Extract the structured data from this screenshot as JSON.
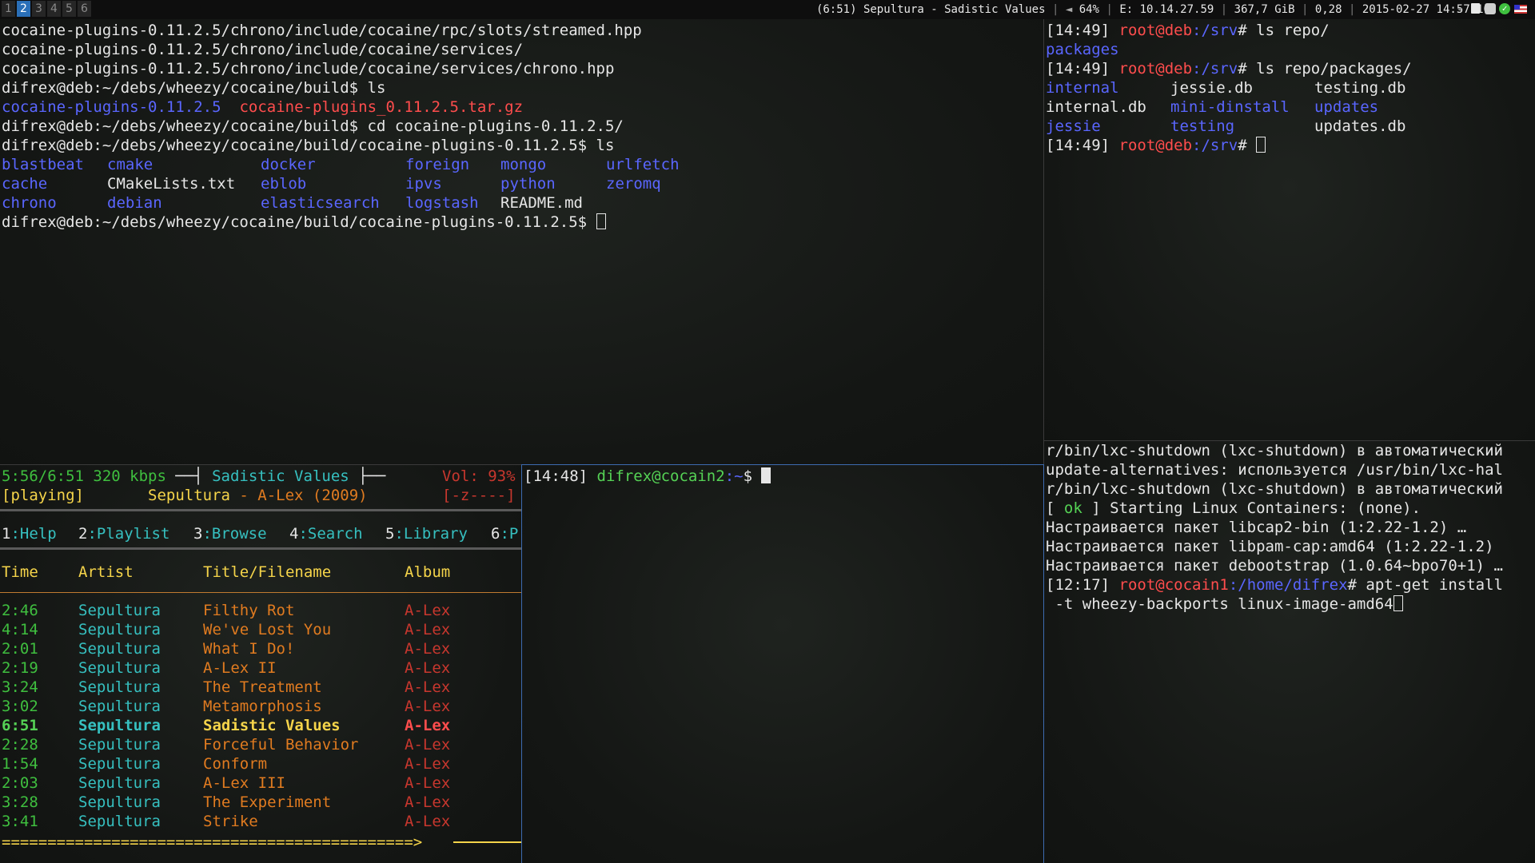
{
  "topbar": {
    "workspaces": [
      "1",
      "2",
      "3",
      "4",
      "5",
      "6"
    ],
    "active_workspace": "2",
    "now_playing": "(6:51) Sepultura - Sadistic Values",
    "battery": "64%",
    "ethernet": "E: 10.14.27.59",
    "disk": "367,7 GiB",
    "load": "0,28",
    "datetime": "2015-02-27 14:57:10",
    "sep": "|",
    "tray_icons": [
      "volume-icon",
      "clipboard-icon",
      "chat-icon",
      "check-icon",
      "flag-icon"
    ]
  },
  "term1": {
    "lines": [
      "cocaine-plugins-0.11.2.5/chrono/include/cocaine/rpc/slots/streamed.hpp",
      "cocaine-plugins-0.11.2.5/chrono/include/cocaine/services/",
      "cocaine-plugins-0.11.2.5/chrono/include/cocaine/services/chrono.hpp",
      "difrex@deb:~/debs/wheezy/cocaine/build$ ls"
    ],
    "ls1": {
      "dir": "cocaine-plugins-0.11.2.5",
      "archive": "cocaine-plugins_0.11.2.5.tar.gz"
    },
    "cmd_cd": "difrex@deb:~/debs/wheezy/cocaine/build$ cd cocaine-plugins-0.11.2.5/",
    "cmd_ls": "difrex@deb:~/debs/wheezy/cocaine/build/cocaine-plugins-0.11.2.5$ ls",
    "ls_rows": [
      [
        {
          "t": "blastbeat",
          "k": "dir"
        },
        {
          "t": "cmake",
          "k": "dir"
        },
        {
          "t": "docker",
          "k": "dir"
        },
        {
          "t": "foreign",
          "k": "dir"
        },
        {
          "t": "mongo",
          "k": "dir"
        },
        {
          "t": "urlfetch",
          "k": "dir"
        }
      ],
      [
        {
          "t": "cache",
          "k": "dir"
        },
        {
          "t": "CMakeLists.txt",
          "k": "file"
        },
        {
          "t": "eblob",
          "k": "dir"
        },
        {
          "t": "ipvs",
          "k": "dir"
        },
        {
          "t": "python",
          "k": "dir"
        },
        {
          "t": "zeromq",
          "k": "dir"
        }
      ],
      [
        {
          "t": "chrono",
          "k": "dir"
        },
        {
          "t": "debian",
          "k": "dir"
        },
        {
          "t": "elasticsearch",
          "k": "dir"
        },
        {
          "t": "logstash",
          "k": "dir"
        },
        {
          "t": "README.md",
          "k": "file"
        }
      ]
    ],
    "prompt": "difrex@deb:~/debs/wheezy/cocaine/build/cocaine-plugins-0.11.2.5$ "
  },
  "term2": {
    "p1": {
      "time": "[14:49]",
      "user": "root@deb",
      "path": ":/srv",
      "cmd": "# ls repo/"
    },
    "out1": "packages",
    "p2": {
      "time": "[14:49]",
      "user": "root@deb",
      "path": ":/srv",
      "cmd": "# ls repo/packages/"
    },
    "ls_rows": [
      [
        {
          "t": "internal",
          "k": "dir"
        },
        {
          "t": "jessie.db",
          "k": "file"
        },
        {
          "t": "testing.db",
          "k": "file"
        }
      ],
      [
        {
          "t": "internal.db",
          "k": "file"
        },
        {
          "t": "mini-dinstall",
          "k": "dir"
        },
        {
          "t": "updates",
          "k": "dir"
        }
      ],
      [
        {
          "t": "jessie",
          "k": "dir"
        },
        {
          "t": "testing",
          "k": "dir"
        },
        {
          "t": "updates.db",
          "k": "file"
        }
      ]
    ],
    "p3": {
      "time": "[14:49]",
      "user": "root@deb",
      "path": ":/srv",
      "cmd": "# "
    }
  },
  "ncmpcpp": {
    "progress": "5:56/6:51 320 kbps",
    "title": "Sadistic Values",
    "vol": "Vol: 93%",
    "state": "[playing]",
    "artist": "Sepultura",
    "album_info": " - A-Lex (2009)",
    "flags": "[-z----]",
    "menu": [
      {
        "n": "1",
        "l": ":Help"
      },
      {
        "n": "2",
        "l": ":Playlist"
      },
      {
        "n": "3",
        "l": ":Browse"
      },
      {
        "n": "4",
        "l": ":Search"
      },
      {
        "n": "5",
        "l": ":Library"
      },
      {
        "n": "6",
        "l": ":P"
      }
    ],
    "headers": [
      "Time",
      "Artist",
      "Title/Filename",
      "Album"
    ],
    "tracks": [
      {
        "time": "2:46",
        "artist": "Sepultura",
        "title": "Filthy Rot",
        "album": "A-Lex"
      },
      {
        "time": "4:14",
        "artist": "Sepultura",
        "title": "We've Lost You",
        "album": "A-Lex"
      },
      {
        "time": "2:01",
        "artist": "Sepultura",
        "title": "What I Do!",
        "album": "A-Lex"
      },
      {
        "time": "2:19",
        "artist": "Sepultura",
        "title": "A-Lex II",
        "album": "A-Lex"
      },
      {
        "time": "3:24",
        "artist": "Sepultura",
        "title": "The Treatment",
        "album": "A-Lex"
      },
      {
        "time": "3:02",
        "artist": "Sepultura",
        "title": "Metamorphosis",
        "album": "A-Lex"
      },
      {
        "time": "6:51",
        "artist": "Sepultura",
        "title": "Sadistic Values",
        "album": "A-Lex",
        "current": true
      },
      {
        "time": "2:28",
        "artist": "Sepultura",
        "title": "Forceful Behavior",
        "album": "A-Lex"
      },
      {
        "time": "1:54",
        "artist": "Sepultura",
        "title": "Conform",
        "album": "A-Lex"
      },
      {
        "time": "2:03",
        "artist": "Sepultura",
        "title": "A-Lex III",
        "album": "A-Lex"
      },
      {
        "time": "3:28",
        "artist": "Sepultura",
        "title": "The Experiment",
        "album": "A-Lex"
      },
      {
        "time": "3:41",
        "artist": "Sepultura",
        "title": "Strike",
        "album": "A-Lex"
      }
    ],
    "progressbar": "=============================================>",
    "track_progress": 0.87
  },
  "term3": {
    "time": "[14:48]",
    "user": "difrex@cocain2",
    "path": ":~",
    "cmd": "$ "
  },
  "term4": {
    "lines": [
      "r/bin/lxc-shutdown (lxc-shutdown) в автоматический",
      "update-alternatives: используется /usr/bin/lxc-hal",
      "r/bin/lxc-shutdown (lxc-shutdown) в автоматический"
    ],
    "ok_open": "[ ",
    "ok": "ok",
    "ok_rest": " ] Starting Linux Containers: (none).",
    "lines2": [
      "Настраивается пакет libcap2-bin (1:2.22-1.2) …",
      "Настраивается пакет libpam-cap:amd64 (1:2.22-1.2)",
      "Настраивается пакет debootstrap (1.0.64~bpo70+1) …"
    ],
    "prompt": {
      "time": "[12:17]",
      "user": "root@cocain1",
      "path": ":/home/difrex",
      "cmd": "# apt-get install"
    },
    "cont": " -t wheezy-backports linux-image-amd64"
  }
}
